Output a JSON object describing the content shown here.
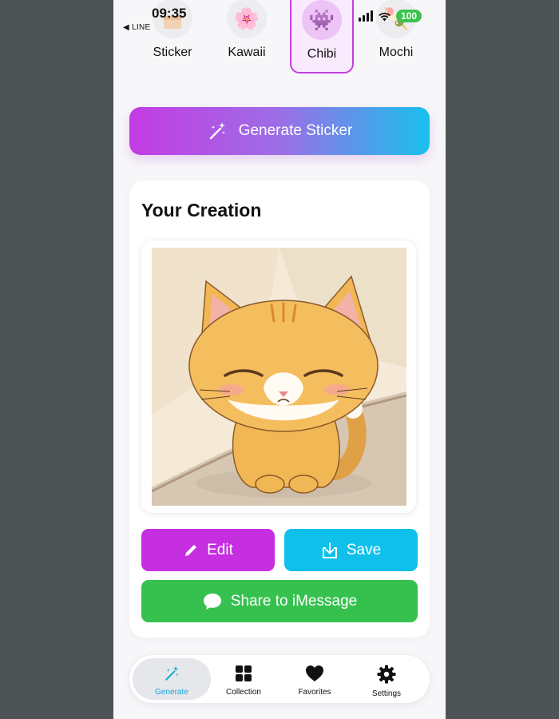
{
  "status_bar": {
    "time": "09:35",
    "back_app": "◀ LINE",
    "battery": "100"
  },
  "styles": [
    {
      "label": "Sticker",
      "icon": "sticker-icon",
      "selected": false
    },
    {
      "label": "Kawaii",
      "icon": "cherry-blossom-icon",
      "emoji": "🌸",
      "selected": false
    },
    {
      "label": "Chibi",
      "icon": "space-invader-icon",
      "emoji": "👾",
      "selected": true
    },
    {
      "label": "Mochi",
      "icon": "dango-icon",
      "emoji": "🍡",
      "selected": false
    }
  ],
  "generate_button": {
    "label": "Generate Sticker",
    "icon": "magic-wand-icon"
  },
  "creation": {
    "title": "Your Creation",
    "image_alt": "sleeping-orange-kitten-sticker"
  },
  "actions": {
    "edit": "Edit",
    "save": "Save",
    "share": "Share to iMessage"
  },
  "tabbar": [
    {
      "label": "Generate",
      "icon": "magic-wand-icon",
      "active": true
    },
    {
      "label": "Collection",
      "icon": "grid-icon",
      "active": false
    },
    {
      "label": "Favorites",
      "icon": "heart-icon",
      "active": false
    },
    {
      "label": "Settings",
      "icon": "gear-icon",
      "active": false
    }
  ],
  "colors": {
    "accent_purple": "#c52fe0",
    "accent_cyan": "#0fc0ea",
    "accent_green": "#36c14f",
    "active_tab": "#19a4d8"
  }
}
